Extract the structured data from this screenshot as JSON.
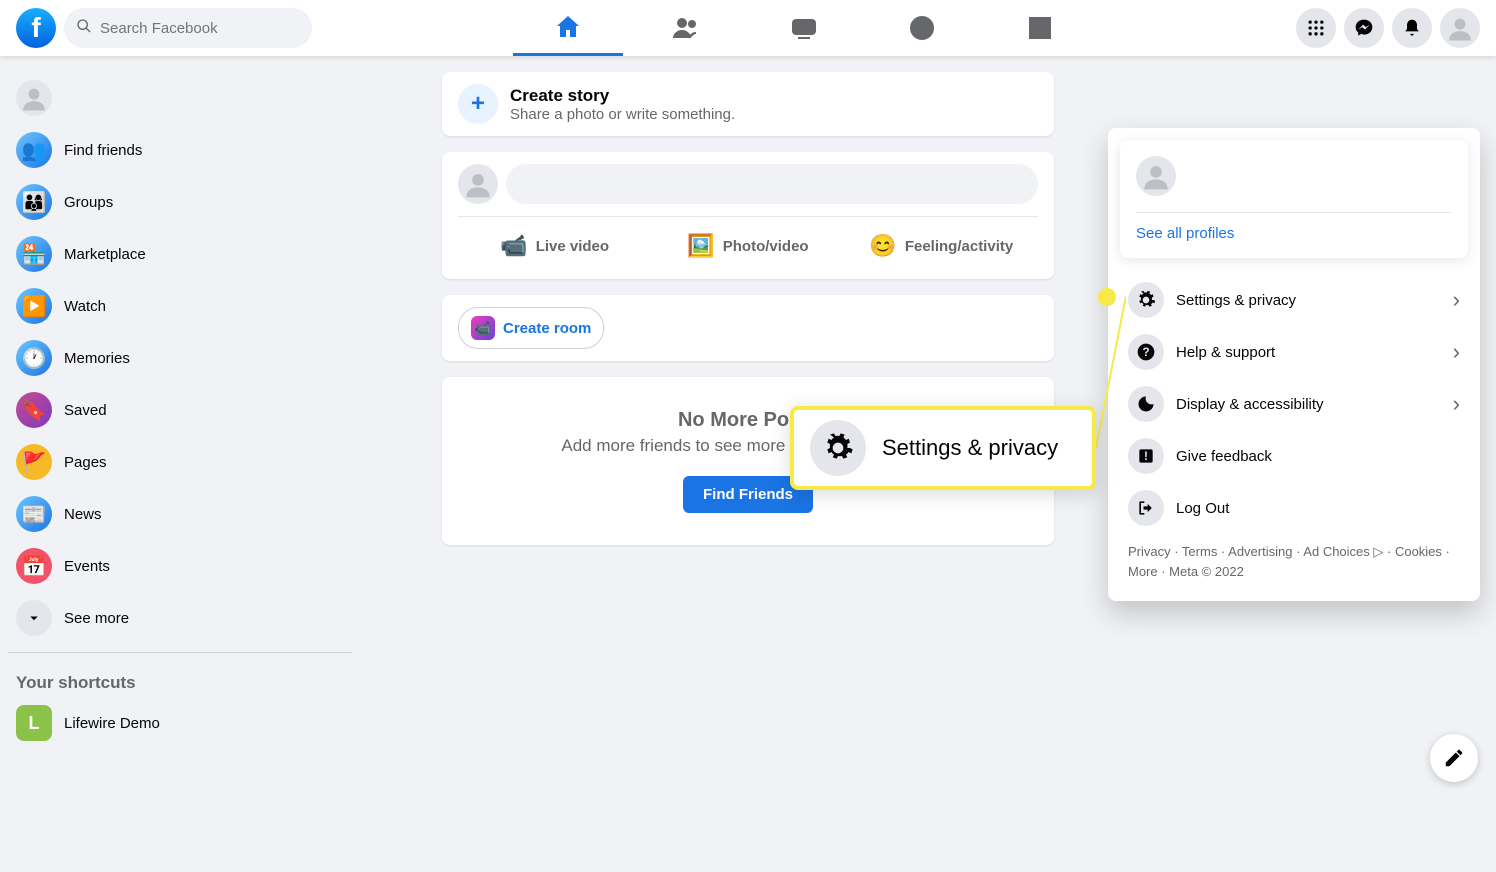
{
  "search": {
    "placeholder": "Search Facebook"
  },
  "sidebar": {
    "items": [
      {
        "label": "Find friends"
      },
      {
        "label": "Groups"
      },
      {
        "label": "Marketplace"
      },
      {
        "label": "Watch"
      },
      {
        "label": "Memories"
      },
      {
        "label": "Saved"
      },
      {
        "label": "Pages"
      },
      {
        "label": "News"
      },
      {
        "label": "Events"
      }
    ],
    "see_more": "See more",
    "shortcuts_heading": "Your shortcuts",
    "shortcuts": [
      {
        "label": "Lifewire Demo",
        "initial": "L"
      }
    ]
  },
  "story": {
    "title": "Create story",
    "subtitle": "Share a photo or write something."
  },
  "composer": {
    "actions": [
      {
        "label": "Live video"
      },
      {
        "label": "Photo/video"
      },
      {
        "label": "Feeling/activity"
      }
    ]
  },
  "room": {
    "label": "Create room"
  },
  "no_posts": {
    "title": "No More Posts",
    "subtitle": "Add more friends to see more posts in your Feed.",
    "button": "Find Friends"
  },
  "menu": {
    "see_all": "See all profiles",
    "items": [
      {
        "label": "Settings & privacy",
        "chevron": true
      },
      {
        "label": "Help & support",
        "chevron": true
      },
      {
        "label": "Display & accessibility",
        "chevron": true
      },
      {
        "label": "Give feedback",
        "chevron": false
      },
      {
        "label": "Log Out",
        "chevron": false
      }
    ],
    "footer": "Privacy · Terms · Advertising · Ad Choices ▷ · Cookies · More · Meta © 2022"
  },
  "callout": {
    "label": "Settings & privacy"
  }
}
